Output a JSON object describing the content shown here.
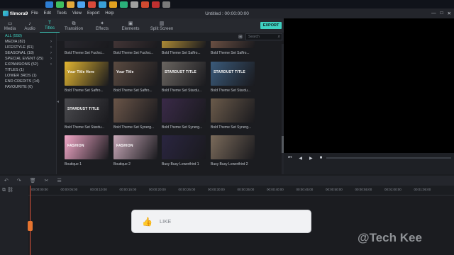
{
  "taskbar": {
    "apps": [
      "#2d7dd2",
      "#3fbf5f",
      "#e3a93b",
      "#4ea4f0",
      "#d84a3a",
      "#39a0d8",
      "#e0a020",
      "#2ab07a",
      "#a0a0a0",
      "#d04a30",
      "#c03030",
      "#7a7a7a"
    ]
  },
  "app": {
    "name": "filmora9",
    "window_title": "Untitled : 00:00:00:00"
  },
  "menu": [
    "File",
    "Edit",
    "Tools",
    "View",
    "Export",
    "Help"
  ],
  "window_controls": [
    "—",
    "□",
    "✕"
  ],
  "tabs": [
    {
      "label": "Media",
      "icon": "folder-icon"
    },
    {
      "label": "Audio",
      "icon": "music-icon"
    },
    {
      "label": "Titles",
      "icon": "text-icon",
      "active": true
    },
    {
      "label": "Transition",
      "icon": "transition-icon"
    },
    {
      "label": "Effects",
      "icon": "effects-icon"
    },
    {
      "label": "Elements",
      "icon": "image-icon"
    },
    {
      "label": "Split Screen",
      "icon": "split-icon"
    }
  ],
  "export_label": "EXPORT",
  "search": {
    "placeholder": "Search"
  },
  "categories": [
    {
      "label": "ALL (558)",
      "active": true
    },
    {
      "label": "MEDIA (82)",
      "arrow": true
    },
    {
      "label": "LIFESTYLE (61)",
      "arrow": true
    },
    {
      "label": "SEASONAL (18)",
      "arrow": true
    },
    {
      "label": "SPECIAL EVENT (25)",
      "arrow": true
    },
    {
      "label": "EXPANSIONS (52)",
      "arrow": true
    },
    {
      "label": "TITLES (1)"
    },
    {
      "label": "LOWER 3RDS (1)"
    },
    {
      "label": "END CREDITS (14)"
    },
    {
      "label": "FAVOURITE (0)"
    }
  ],
  "library": [
    {
      "label": "Bold Theme Set Fuchsi...",
      "bg": "#2b2a30",
      "text": ""
    },
    {
      "label": "Bold Theme Set Fuchsi...",
      "bg": "#4a3a3a",
      "text": ""
    },
    {
      "label": "Bold Theme Set Saffro...",
      "bg": "#c9a03a",
      "text": ""
    },
    {
      "label": "Bold Theme Set Saffro...",
      "bg": "#7a5a4a",
      "text": ""
    },
    {
      "label": "Bold Theme Set Saffro...",
      "bg": "#e2b531",
      "text": "Your Title Here"
    },
    {
      "label": "Bold Theme Set Saffro...",
      "bg": "#5a4a40",
      "text": "Your Title"
    },
    {
      "label": "Bold Theme Set Stardu...",
      "bg": "#6a6560",
      "text": "STARDUST TITLE"
    },
    {
      "label": "Bold Theme Set Stardu...",
      "bg": "#3a5a7a",
      "text": "STARDUST TITLE"
    },
    {
      "label": "Bold Theme Set Stardu...",
      "bg": "#4a4a4e",
      "text": "STARDUST TITLE"
    },
    {
      "label": "Bold Theme Set Synerg...",
      "bg": "#6a5548",
      "text": ""
    },
    {
      "label": "Bold Theme Set Synerg...",
      "bg": "#3a2a48",
      "text": ""
    },
    {
      "label": "Bold Theme Set Synerg...",
      "bg": "#6a5a4a",
      "text": ""
    },
    {
      "label": "Boutique 1",
      "bg": "#f3a8c8",
      "text": "FASHION"
    },
    {
      "label": "Boutique 2",
      "bg": "#c8a8b8",
      "text": "FASHION"
    },
    {
      "label": "Busy Busy Lowerthird 1",
      "bg": "#2a2540",
      "text": ""
    },
    {
      "label": "Busy Busy Lowerthird 2",
      "bg": "#7a6a5a",
      "text": ""
    }
  ],
  "player": {
    "controls": [
      "⏮",
      "◀",
      "▶",
      "■"
    ]
  },
  "timeline": {
    "tools": [
      "↶",
      "↷",
      "🗑",
      "✂",
      "☰"
    ],
    "ticks": [
      "00:00:00:00",
      "00:00:05:00",
      "00:00:10:00",
      "00:00:15:00",
      "00:00:20:00",
      "00:00:25:00",
      "00:00:30:00",
      "00:00:35:00",
      "00:00:40:00",
      "00:00:45:00",
      "00:00:50:00",
      "00:00:55:00",
      "00:01:00:00",
      "00:01:05:00"
    ]
  },
  "like_overlay": {
    "label": "LIKE"
  },
  "watermark": "@Tech Kee"
}
